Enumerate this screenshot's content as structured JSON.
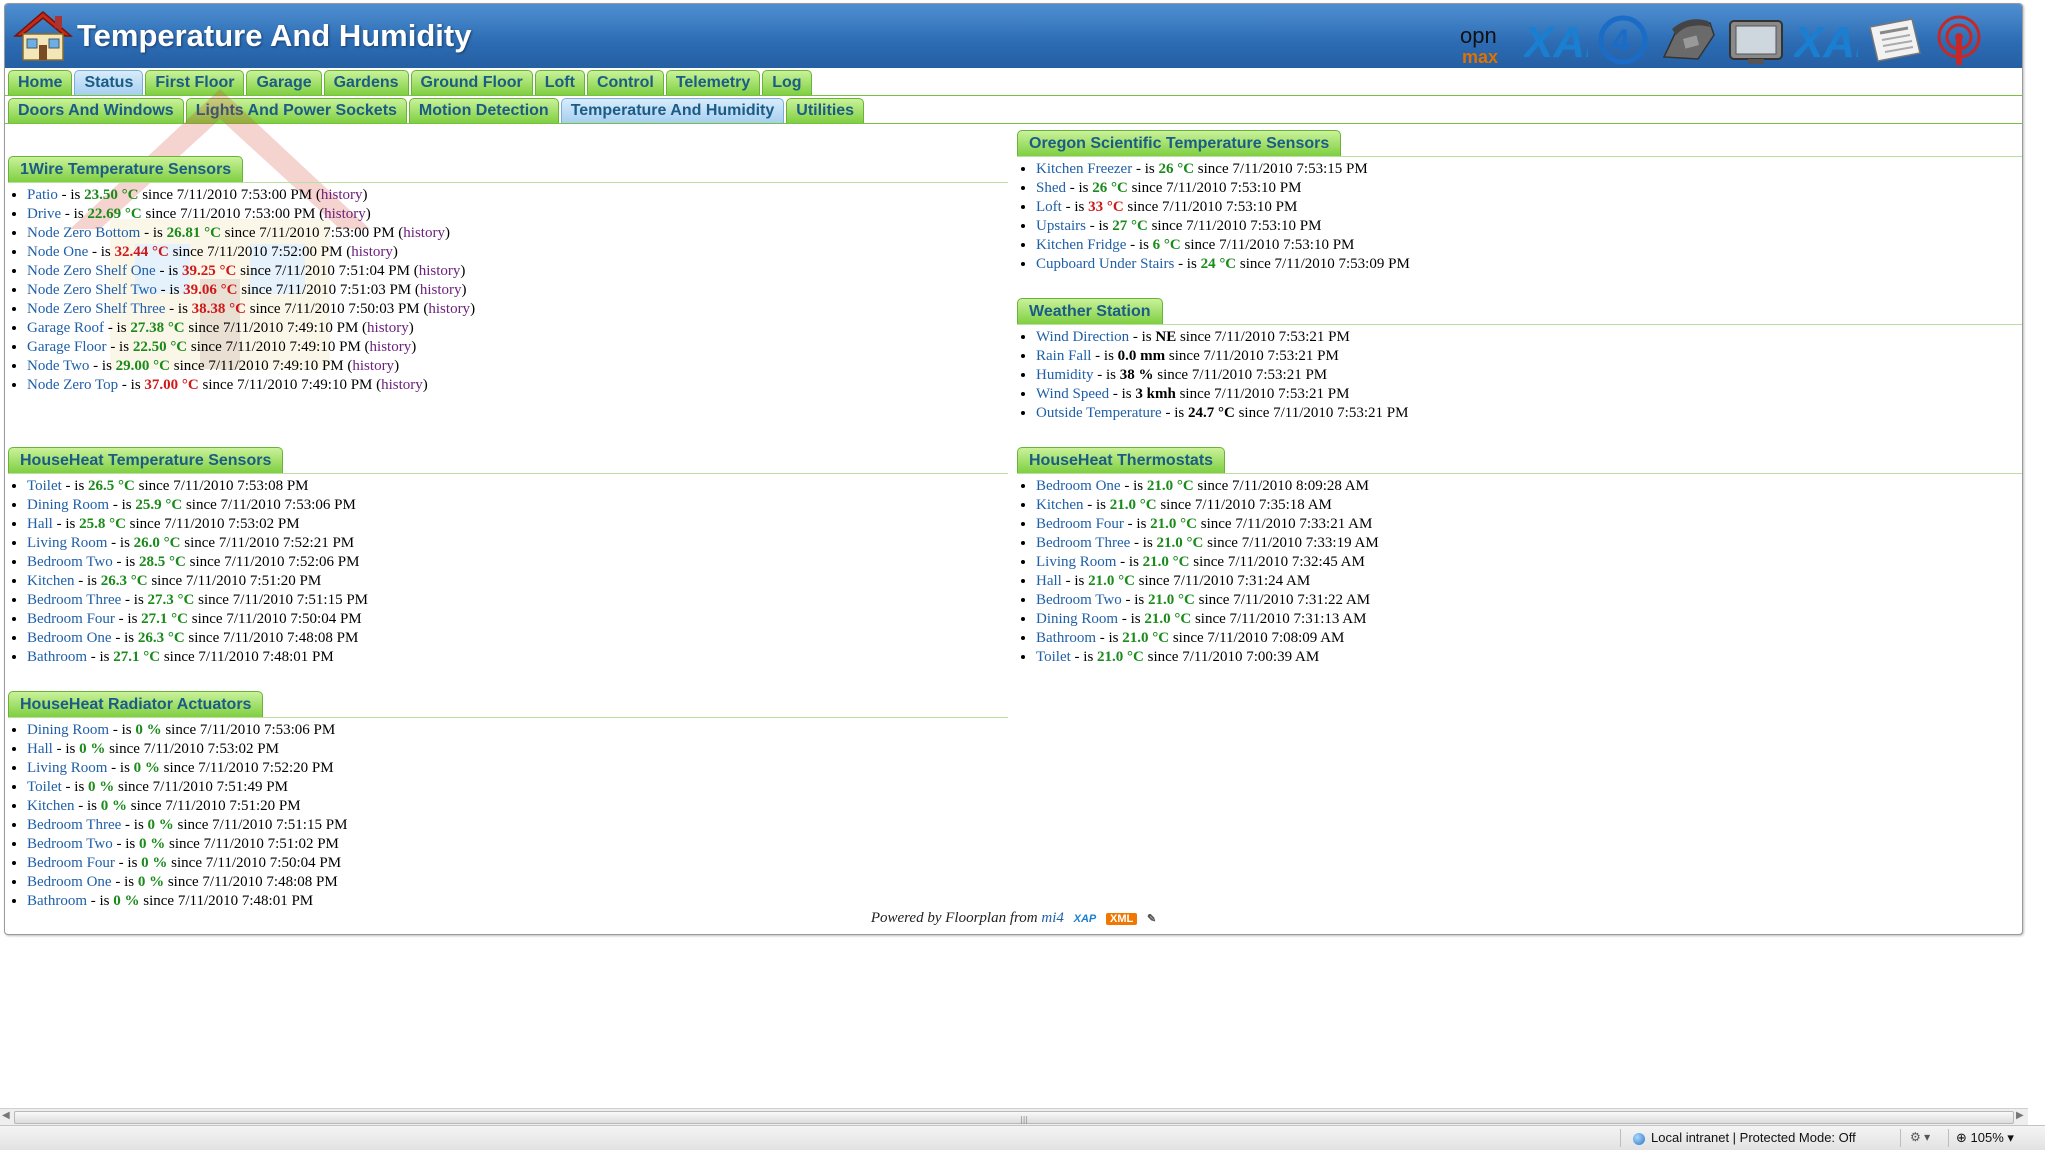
{
  "app": {
    "title": "Temperature And Humidity"
  },
  "header_logos": [
    "openmax",
    "xAP",
    "circle-4",
    "phone",
    "tv",
    "xAP",
    "newspaper",
    "antenna"
  ],
  "nav": {
    "row1": [
      "Home",
      "Status",
      "First Floor",
      "Garage",
      "Gardens",
      "Ground Floor",
      "Loft",
      "Control",
      "Telemetry",
      "Log"
    ],
    "row1_active": "Status",
    "row2": [
      "Doors And Windows",
      "Lights And Power Sockets",
      "Motion Detection",
      "Temperature And Humidity",
      "Utilities"
    ],
    "row2_active": "Temperature And Humidity"
  },
  "labels": {
    "is": "- is",
    "since": "since",
    "history": "history"
  },
  "sections": {
    "onewire": {
      "title": "1Wire Temperature Sensors",
      "items": [
        {
          "name": "Patio",
          "value": "23.50 °C",
          "color": "g",
          "since": "7/11/2010 7:53:00 PM",
          "history": true
        },
        {
          "name": "Drive",
          "value": "22.69 °C",
          "color": "g",
          "since": "7/11/2010 7:53:00 PM",
          "history": true
        },
        {
          "name": "Node Zero Bottom",
          "value": "26.81 °C",
          "color": "g",
          "since": "7/11/2010 7:53:00 PM",
          "history": true
        },
        {
          "name": "Node One",
          "value": "32.44 °C",
          "color": "r",
          "since": "7/11/2010 7:52:00 PM",
          "history": true
        },
        {
          "name": "Node Zero Shelf One",
          "value": "39.25 °C",
          "color": "r",
          "since": "7/11/2010 7:51:04 PM",
          "history": true
        },
        {
          "name": "Node Zero Shelf Two",
          "value": "39.06 °C",
          "color": "r",
          "since": "7/11/2010 7:51:03 PM",
          "history": true
        },
        {
          "name": "Node Zero Shelf Three",
          "value": "38.38 °C",
          "color": "r",
          "since": "7/11/2010 7:50:03 PM",
          "history": true
        },
        {
          "name": "Garage Roof",
          "value": "27.38 °C",
          "color": "g",
          "since": "7/11/2010 7:49:10 PM",
          "history": true
        },
        {
          "name": "Garage Floor",
          "value": "22.50 °C",
          "color": "g",
          "since": "7/11/2010 7:49:10 PM",
          "history": true
        },
        {
          "name": "Node Two",
          "value": "29.00 °C",
          "color": "g",
          "since": "7/11/2010 7:49:10 PM",
          "history": true
        },
        {
          "name": "Node Zero Top",
          "value": "37.00 °C",
          "color": "r",
          "since": "7/11/2010 7:49:10 PM",
          "history": true
        }
      ]
    },
    "oregon": {
      "title": "Oregon Scientific Temperature Sensors",
      "items": [
        {
          "name": "Kitchen Freezer",
          "value": "26 °C",
          "color": "g",
          "since": "7/11/2010 7:53:15 PM"
        },
        {
          "name": "Shed",
          "value": "26 °C",
          "color": "g",
          "since": "7/11/2010 7:53:10 PM"
        },
        {
          "name": "Loft",
          "value": "33 °C",
          "color": "r",
          "since": "7/11/2010 7:53:10 PM"
        },
        {
          "name": "Upstairs",
          "value": "27 °C",
          "color": "g",
          "since": "7/11/2010 7:53:10 PM"
        },
        {
          "name": "Kitchen Fridge",
          "value": "6 °C",
          "color": "g",
          "since": "7/11/2010 7:53:10 PM"
        },
        {
          "name": "Cupboard Under Stairs",
          "value": "24 °C",
          "color": "g",
          "since": "7/11/2010 7:53:09 PM"
        }
      ]
    },
    "weather": {
      "title": "Weather Station",
      "items": [
        {
          "name": "Wind Direction",
          "value": "NE",
          "color": "k",
          "since": "7/11/2010 7:53:21 PM"
        },
        {
          "name": "Rain Fall",
          "value": "0.0 mm",
          "color": "k",
          "since": "7/11/2010 7:53:21 PM"
        },
        {
          "name": "Humidity",
          "value": "38 %",
          "color": "k",
          "since": "7/11/2010 7:53:21 PM"
        },
        {
          "name": "Wind Speed",
          "value": "3 kmh",
          "color": "k",
          "since": "7/11/2010 7:53:21 PM"
        },
        {
          "name": "Outside Temperature",
          "value": "24.7 °C",
          "color": "k",
          "since": "7/11/2010 7:53:21 PM"
        }
      ]
    },
    "hh_sensors": {
      "title": "HouseHeat Temperature Sensors",
      "items": [
        {
          "name": "Toilet",
          "value": "26.5 °C",
          "color": "g",
          "since": "7/11/2010 7:53:08 PM"
        },
        {
          "name": "Dining Room",
          "value": "25.9 °C",
          "color": "g",
          "since": "7/11/2010 7:53:06 PM"
        },
        {
          "name": "Hall",
          "value": "25.8 °C",
          "color": "g",
          "since": "7/11/2010 7:53:02 PM"
        },
        {
          "name": "Living Room",
          "value": "26.0 °C",
          "color": "g",
          "since": "7/11/2010 7:52:21 PM"
        },
        {
          "name": "Bedroom Two",
          "value": "28.5 °C",
          "color": "g",
          "since": "7/11/2010 7:52:06 PM"
        },
        {
          "name": "Kitchen",
          "value": "26.3 °C",
          "color": "g",
          "since": "7/11/2010 7:51:20 PM"
        },
        {
          "name": "Bedroom Three",
          "value": "27.3 °C",
          "color": "g",
          "since": "7/11/2010 7:51:15 PM"
        },
        {
          "name": "Bedroom Four",
          "value": "27.1 °C",
          "color": "g",
          "since": "7/11/2010 7:50:04 PM"
        },
        {
          "name": "Bedroom One",
          "value": "26.3 °C",
          "color": "g",
          "since": "7/11/2010 7:48:08 PM"
        },
        {
          "name": "Bathroom",
          "value": "27.1 °C",
          "color": "g",
          "since": "7/11/2010 7:48:01 PM"
        }
      ]
    },
    "hh_thermostats": {
      "title": "HouseHeat Thermostats",
      "items": [
        {
          "name": "Bedroom One",
          "value": "21.0 °C",
          "color": "g",
          "since": "7/11/2010 8:09:28 AM"
        },
        {
          "name": "Kitchen",
          "value": "21.0 °C",
          "color": "g",
          "since": "7/11/2010 7:35:18 AM"
        },
        {
          "name": "Bedroom Four",
          "value": "21.0 °C",
          "color": "g",
          "since": "7/11/2010 7:33:21 AM"
        },
        {
          "name": "Bedroom Three",
          "value": "21.0 °C",
          "color": "g",
          "since": "7/11/2010 7:33:19 AM"
        },
        {
          "name": "Living Room",
          "value": "21.0 °C",
          "color": "g",
          "since": "7/11/2010 7:32:45 AM"
        },
        {
          "name": "Hall",
          "value": "21.0 °C",
          "color": "g",
          "since": "7/11/2010 7:31:24 AM"
        },
        {
          "name": "Bedroom Two",
          "value": "21.0 °C",
          "color": "g",
          "since": "7/11/2010 7:31:22 AM"
        },
        {
          "name": "Dining Room",
          "value": "21.0 °C",
          "color": "g",
          "since": "7/11/2010 7:31:13 AM"
        },
        {
          "name": "Bathroom",
          "value": "21.0 °C",
          "color": "g",
          "since": "7/11/2010 7:08:09 AM"
        },
        {
          "name": "Toilet",
          "value": "21.0 °C",
          "color": "g",
          "since": "7/11/2010 7:00:39 AM"
        }
      ]
    },
    "hh_actuators": {
      "title": "HouseHeat Radiator Actuators",
      "items": [
        {
          "name": "Dining Room",
          "value": "0 %",
          "color": "g",
          "since": "7/11/2010 7:53:06 PM"
        },
        {
          "name": "Hall",
          "value": "0 %",
          "color": "g",
          "since": "7/11/2010 7:53:02 PM"
        },
        {
          "name": "Living Room",
          "value": "0 %",
          "color": "g",
          "since": "7/11/2010 7:52:20 PM"
        },
        {
          "name": "Toilet",
          "value": "0 %",
          "color": "g",
          "since": "7/11/2010 7:51:49 PM"
        },
        {
          "name": "Kitchen",
          "value": "0 %",
          "color": "g",
          "since": "7/11/2010 7:51:20 PM"
        },
        {
          "name": "Bedroom Three",
          "value": "0 %",
          "color": "g",
          "since": "7/11/2010 7:51:15 PM"
        },
        {
          "name": "Bedroom Two",
          "value": "0 %",
          "color": "g",
          "since": "7/11/2010 7:51:02 PM"
        },
        {
          "name": "Bedroom Four",
          "value": "0 %",
          "color": "g",
          "since": "7/11/2010 7:50:04 PM"
        },
        {
          "name": "Bedroom One",
          "value": "0 %",
          "color": "g",
          "since": "7/11/2010 7:48:08 PM"
        },
        {
          "name": "Bathroom",
          "value": "0 %",
          "color": "g",
          "since": "7/11/2010 7:48:01 PM"
        }
      ]
    }
  },
  "footer": {
    "text": "Powered by Floorplan from",
    "link": "mi4",
    "badge_xap": "XAP",
    "badge_xml": "XML"
  },
  "statusbar": {
    "zone": "Local intranet | Protected Mode: Off",
    "zoom": "105%"
  },
  "colors": {
    "header": "#2c6cb4",
    "tab_green": "#7fcf41",
    "tab_text": "#1b5c86",
    "value_green": "#1a8a1a",
    "value_red": "#d01818",
    "link": "#1f5fa8"
  }
}
